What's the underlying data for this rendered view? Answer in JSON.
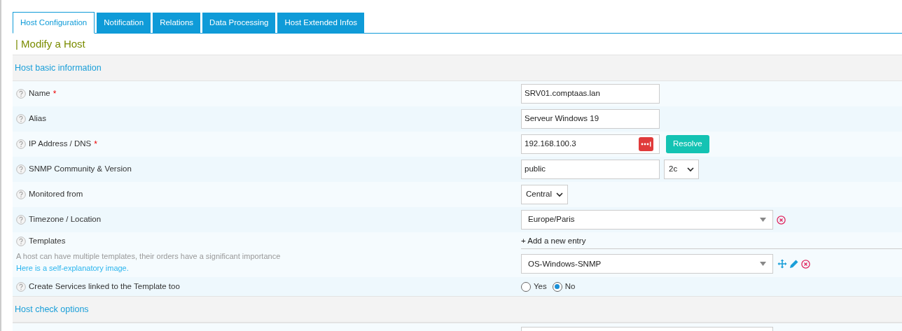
{
  "tabs": [
    {
      "label": "Host Configuration",
      "selected": true
    },
    {
      "label": "Notification",
      "selected": false
    },
    {
      "label": "Relations",
      "selected": false
    },
    {
      "label": "Data Processing",
      "selected": false
    },
    {
      "label": "Host Extended Infos",
      "selected": false
    }
  ],
  "page_title": "| Modify a Host",
  "sections": [
    {
      "title": "Host basic information",
      "rows": [
        {
          "kind": "text",
          "label": "Name",
          "required_mark": "*",
          "value": "SRV01.comptaas.lan"
        },
        {
          "kind": "text",
          "label": "Alias",
          "value": "Serveur Windows 19"
        },
        {
          "kind": "ip",
          "label": "IP Address / DNS",
          "required_mark": "*",
          "value": "192.168.100.3",
          "button": "Resolve"
        },
        {
          "kind": "snmp",
          "label": "SNMP Community & Version",
          "value": "public",
          "version": "2c"
        },
        {
          "kind": "select",
          "label": "Monitored from",
          "value": "Central"
        },
        {
          "kind": "select2",
          "label": "Timezone / Location",
          "value": "Europe/Paris"
        },
        {
          "kind": "templates",
          "label": "Templates",
          "description": "A host can have multiple templates, their orders have a significant importance",
          "link": "Here is a self-explanatory image.",
          "add_label": "+ Add a new entry",
          "value": "OS-Windows-SNMP"
        },
        {
          "kind": "radio",
          "label": "Create Services linked to the Template too",
          "options": [
            {
              "label": "Yes",
              "selected": false
            },
            {
              "label": "No",
              "selected": true
            }
          ]
        }
      ]
    },
    {
      "title": "Host check options",
      "rows": [
        {
          "kind": "partial"
        }
      ]
    }
  ]
}
